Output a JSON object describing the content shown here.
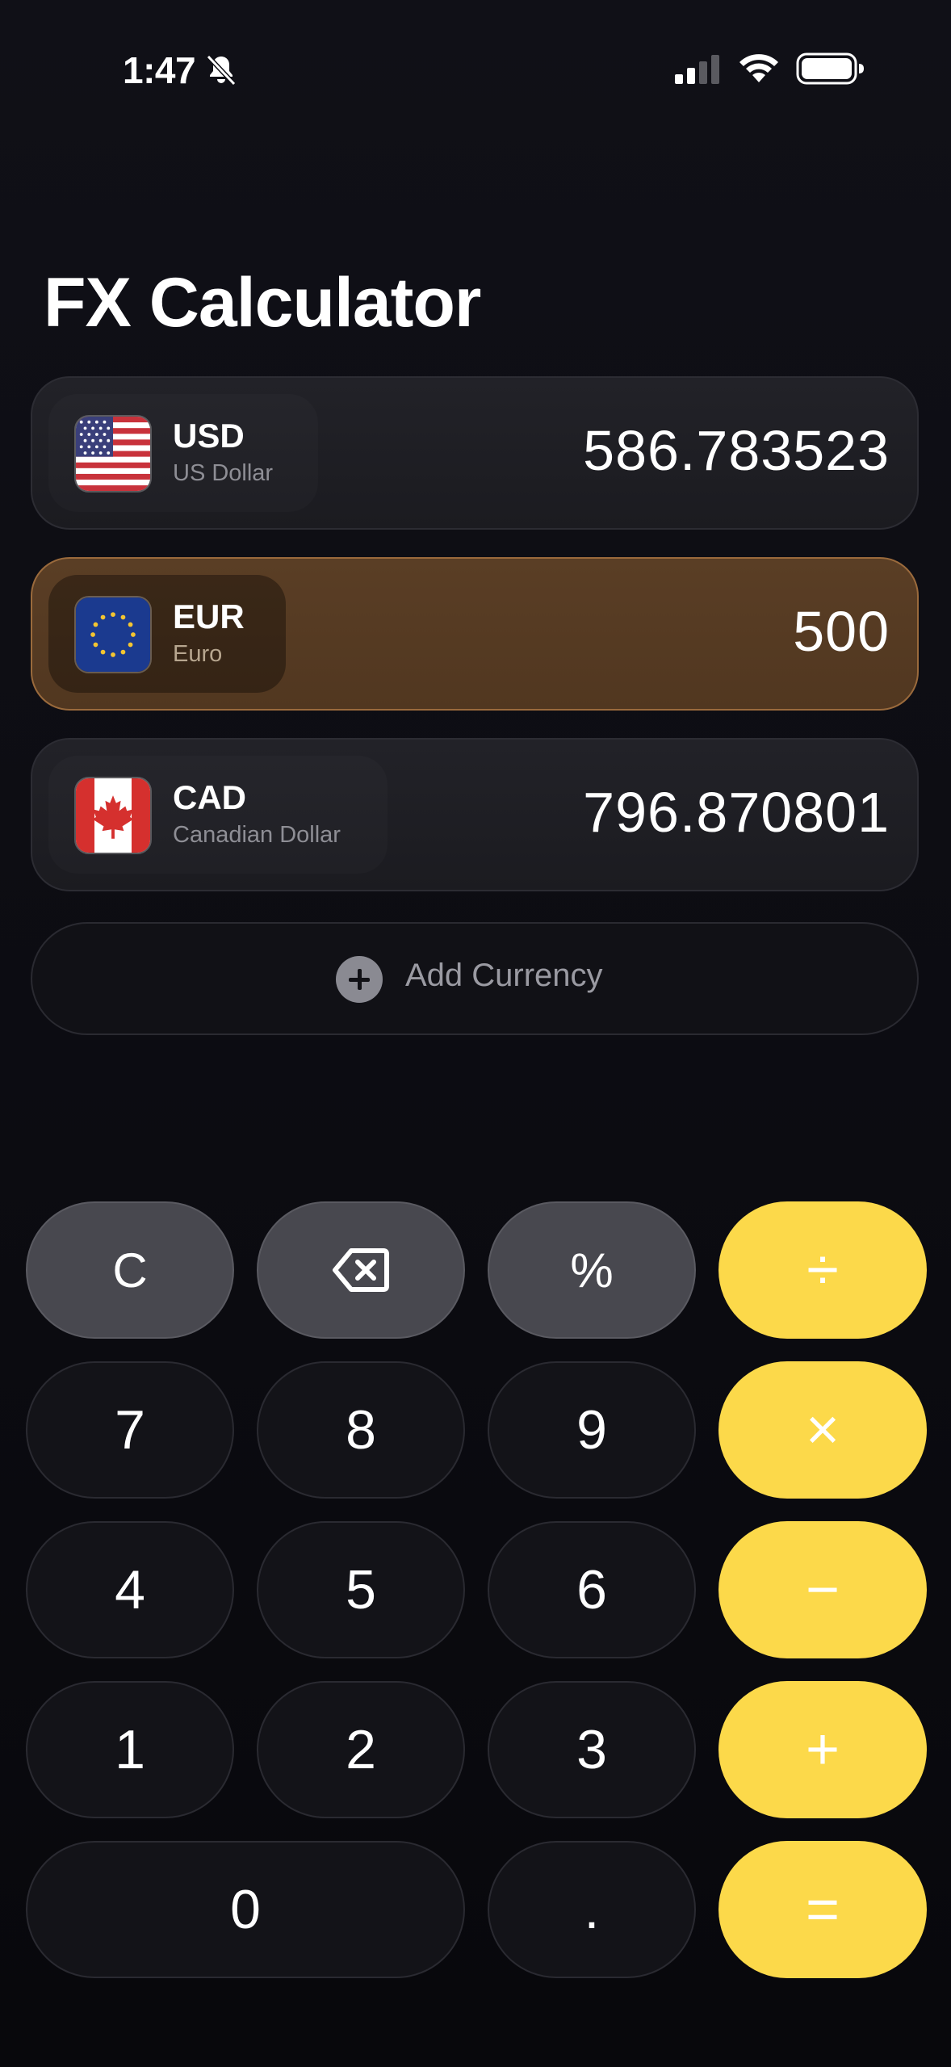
{
  "status_bar": {
    "time": "1:47",
    "icons": [
      "bell-slash-icon",
      "signal-icon",
      "wifi-icon",
      "battery-icon"
    ]
  },
  "title": "FX Calculator",
  "currencies": [
    {
      "code": "USD",
      "name": "US Dollar",
      "amount": "586.783523",
      "flag": "us-flag-icon",
      "active": false
    },
    {
      "code": "EUR",
      "name": "Euro",
      "amount": "500",
      "flag": "eu-flag-icon",
      "active": true
    },
    {
      "code": "CAD",
      "name": "Canadian Dollar",
      "amount": "796.870801",
      "flag": "ca-flag-icon",
      "active": false
    }
  ],
  "add_currency": {
    "label": "Add Currency",
    "icon": "plus-circle-icon"
  },
  "keypad": {
    "clear": "C",
    "backspace_icon": "backspace-icon",
    "percent": "%",
    "divide": "÷",
    "seven": "7",
    "eight": "8",
    "nine": "9",
    "multiply": "×",
    "four": "4",
    "five": "5",
    "six": "6",
    "minus": "−",
    "one": "1",
    "two": "2",
    "three": "3",
    "plus": "+",
    "zero": "0",
    "decimal": ".",
    "equals": "="
  },
  "colors": {
    "background": "#0b0b0f",
    "active_row": "#5a3e25",
    "operator": "#fcd94a",
    "function_key": "#48484f",
    "digit_key": "#131318"
  }
}
